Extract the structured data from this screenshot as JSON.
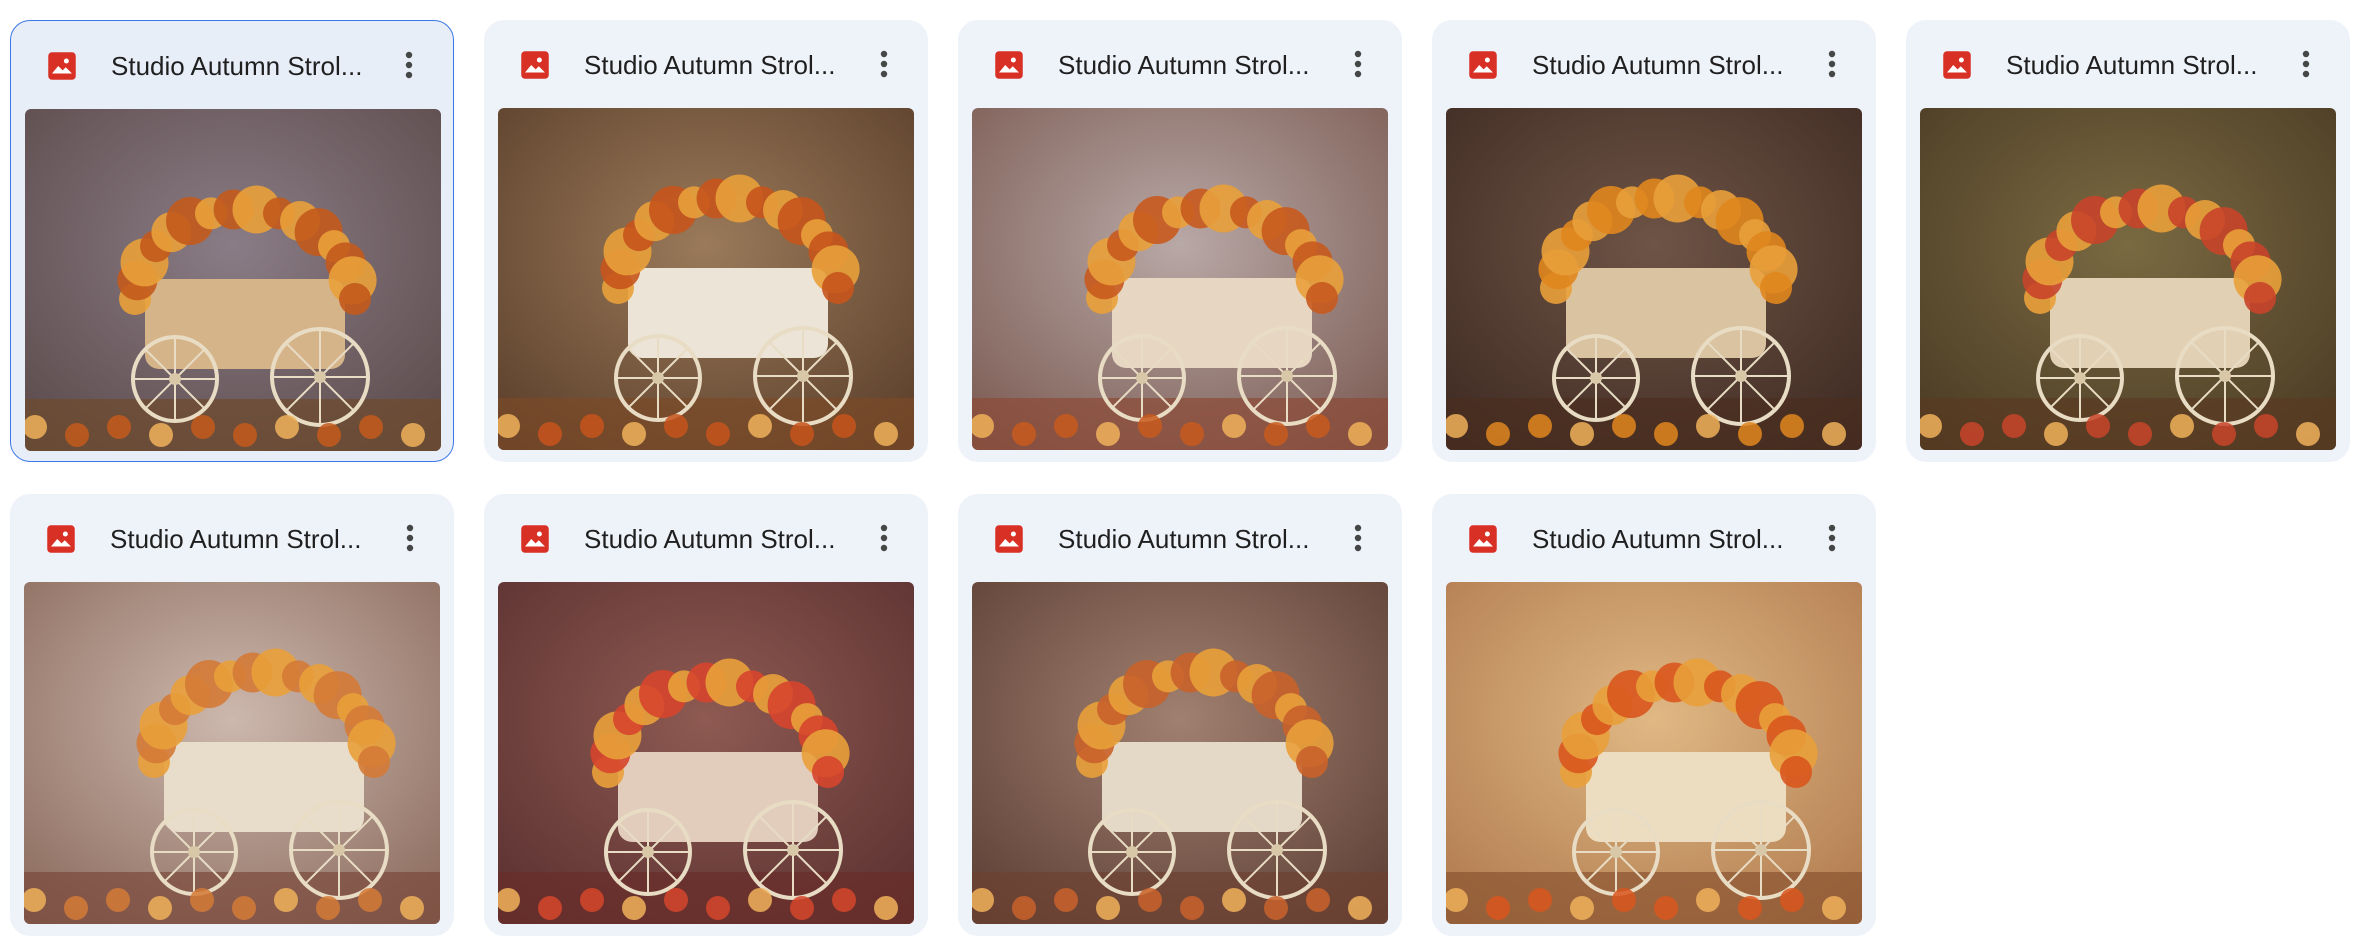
{
  "colors": {
    "card_background": "#eef2f9",
    "selected_border": "#3b78e7",
    "image_icon_red": "#d93025",
    "title_text": "#1f1f1f"
  },
  "files": [
    {
      "title": "Studio Autumn Strol...",
      "icon": "image-file-icon",
      "selected": true,
      "palette": [
        "#5b4a4a",
        "#8a7c86",
        "#c35a1c",
        "#d6b48a",
        "#6d4a2c"
      ]
    },
    {
      "title": "Studio Autumn Strol...",
      "icon": "image-file-icon",
      "selected": false,
      "palette": [
        "#5a3e2a",
        "#9a7a5a",
        "#c7541c",
        "#ece4d6",
        "#7a4a28"
      ]
    },
    {
      "title": "Studio Autumn Strol...",
      "icon": "image-file-icon",
      "selected": false,
      "palette": [
        "#7b5a52",
        "#b8a8a6",
        "#c85a1e",
        "#e6d6c2",
        "#8c4a36"
      ]
    },
    {
      "title": "Studio Autumn Strol...",
      "icon": "image-file-icon",
      "selected": false,
      "palette": [
        "#3e2a22",
        "#6e5446",
        "#e0861e",
        "#d9c3a0",
        "#4a2e20"
      ]
    },
    {
      "title": "Studio Autumn Strol...",
      "icon": "image-file-icon",
      "selected": false,
      "palette": [
        "#4a3a24",
        "#7a6a42",
        "#c8442a",
        "#e2d0b4",
        "#5a3a22"
      ]
    },
    {
      "title": "Studio Autumn Strol...",
      "icon": "image-file-icon",
      "selected": false,
      "palette": [
        "#8a6a5c",
        "#cdb8ae",
        "#d47a36",
        "#e8dccb",
        "#7a4a3c"
      ]
    },
    {
      "title": "Studio Autumn Strol...",
      "icon": "image-file-icon",
      "selected": false,
      "palette": [
        "#5a3030",
        "#8e5a52",
        "#d6452c",
        "#e2cdbd",
        "#6a2e2a"
      ]
    },
    {
      "title": "Studio Autumn Strol...",
      "icon": "image-file-icon",
      "selected": false,
      "palette": [
        "#5c3e34",
        "#a08070",
        "#c9622a",
        "#e4d8c6",
        "#6e4232"
      ]
    },
    {
      "title": "Studio Autumn Strol...",
      "icon": "image-file-icon",
      "selected": false,
      "palette": [
        "#b07a4e",
        "#e0b884",
        "#d9561e",
        "#ecdcc0",
        "#8a5430"
      ]
    }
  ],
  "actions": {
    "more_actions_icon": "more-vert-icon"
  }
}
